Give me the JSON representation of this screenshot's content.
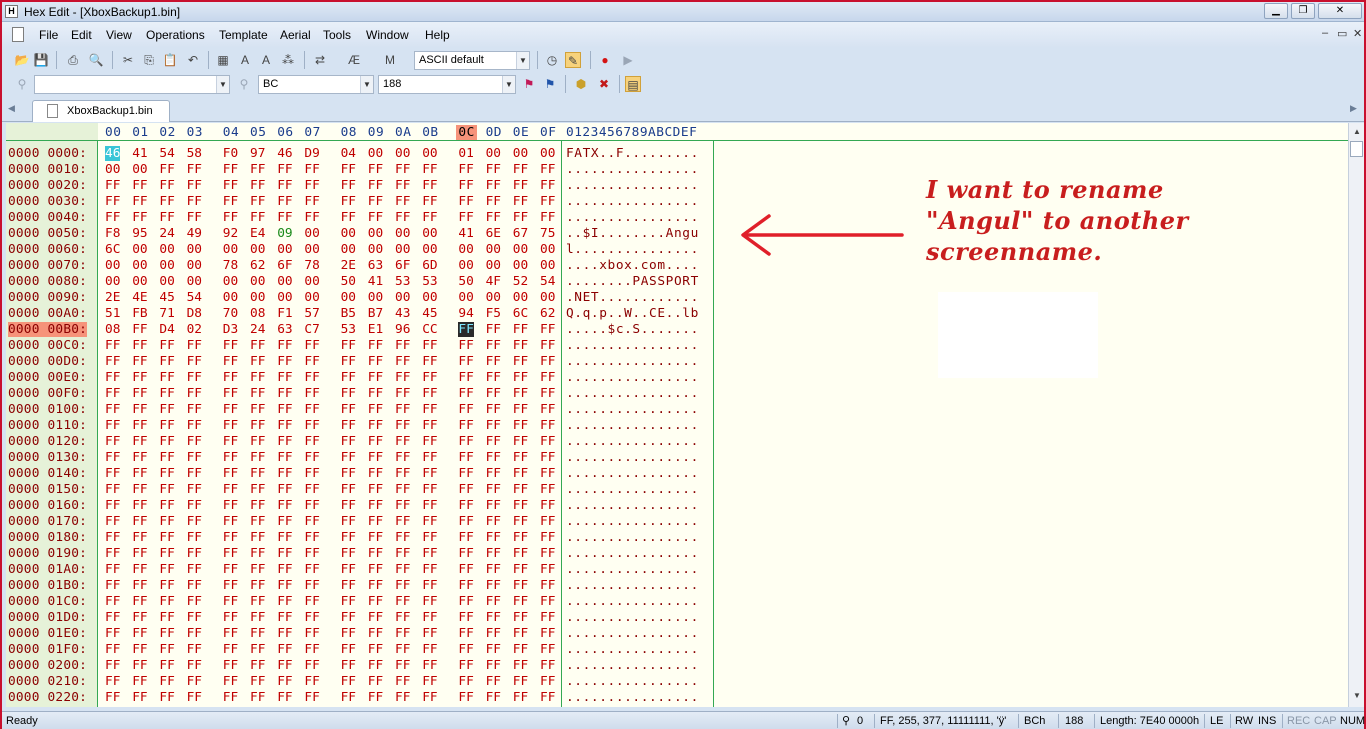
{
  "window": {
    "title": "Hex Edit - [XboxBackup1.bin]",
    "app_icon": "hex-app-icon"
  },
  "menu": [
    "File",
    "Edit",
    "View",
    "Operations",
    "Template",
    "Aerial",
    "Tools",
    "Window",
    "Help"
  ],
  "toolbar": {
    "charset_combo": "ASCII default",
    "find_combo": "",
    "hex_combo": "BC",
    "dec_combo": "188"
  },
  "tab": {
    "label": "XboxBackup1.bin"
  },
  "header": {
    "cols": [
      "00",
      "01",
      "02",
      "03",
      "04",
      "05",
      "06",
      "07",
      "08",
      "09",
      "0A",
      "0B",
      "0C",
      "0D",
      "0E",
      "0F"
    ],
    "ascii_header": "0123456789ABCDEF",
    "current_col": "0C"
  },
  "rows": [
    {
      "addr": "0000 0000:",
      "bytes": [
        "46",
        "41",
        "54",
        "58",
        "F0",
        "97",
        "46",
        "D9",
        "04",
        "00",
        "00",
        "00",
        "01",
        "00",
        "00",
        "00"
      ],
      "ascii": "FATX..F........."
    },
    {
      "addr": "0000 0010:",
      "bytes": [
        "00",
        "00",
        "FF",
        "FF",
        "FF",
        "FF",
        "FF",
        "FF",
        "FF",
        "FF",
        "FF",
        "FF",
        "FF",
        "FF",
        "FF",
        "FF"
      ],
      "ascii": "................"
    },
    {
      "addr": "0000 0020:",
      "bytes": [
        "FF",
        "FF",
        "FF",
        "FF",
        "FF",
        "FF",
        "FF",
        "FF",
        "FF",
        "FF",
        "FF",
        "FF",
        "FF",
        "FF",
        "FF",
        "FF"
      ],
      "ascii": "................"
    },
    {
      "addr": "0000 0030:",
      "bytes": [
        "FF",
        "FF",
        "FF",
        "FF",
        "FF",
        "FF",
        "FF",
        "FF",
        "FF",
        "FF",
        "FF",
        "FF",
        "FF",
        "FF",
        "FF",
        "FF"
      ],
      "ascii": "................"
    },
    {
      "addr": "0000 0040:",
      "bytes": [
        "FF",
        "FF",
        "FF",
        "FF",
        "FF",
        "FF",
        "FF",
        "FF",
        "FF",
        "FF",
        "FF",
        "FF",
        "FF",
        "FF",
        "FF",
        "FF"
      ],
      "ascii": "................"
    },
    {
      "addr": "0000 0050:",
      "bytes": [
        "F8",
        "95",
        "24",
        "49",
        "92",
        "E4",
        "09",
        "00",
        "00",
        "00",
        "00",
        "00",
        "41",
        "6E",
        "67",
        "75"
      ],
      "ascii": "..$I........Angu"
    },
    {
      "addr": "0000 0060:",
      "bytes": [
        "6C",
        "00",
        "00",
        "00",
        "00",
        "00",
        "00",
        "00",
        "00",
        "00",
        "00",
        "00",
        "00",
        "00",
        "00",
        "00"
      ],
      "ascii": "l..............."
    },
    {
      "addr": "0000 0070:",
      "bytes": [
        "00",
        "00",
        "00",
        "00",
        "78",
        "62",
        "6F",
        "78",
        "2E",
        "63",
        "6F",
        "6D",
        "00",
        "00",
        "00",
        "00"
      ],
      "ascii": "....xbox.com...."
    },
    {
      "addr": "0000 0080:",
      "bytes": [
        "00",
        "00",
        "00",
        "00",
        "00",
        "00",
        "00",
        "00",
        "50",
        "41",
        "53",
        "53",
        "50",
        "4F",
        "52",
        "54"
      ],
      "ascii": "........PASSPORT"
    },
    {
      "addr": "0000 0090:",
      "bytes": [
        "2E",
        "4E",
        "45",
        "54",
        "00",
        "00",
        "00",
        "00",
        "00",
        "00",
        "00",
        "00",
        "00",
        "00",
        "00",
        "00"
      ],
      "ascii": ".NET............"
    },
    {
      "addr": "0000 00A0:",
      "bytes": [
        "51",
        "FB",
        "71",
        "D8",
        "70",
        "08",
        "F1",
        "57",
        "B5",
        "B7",
        "43",
        "45",
        "94",
        "F5",
        "6C",
        "62"
      ],
      "ascii": "Q.q.p..W..CE..lb"
    },
    {
      "addr": "0000 00B0:",
      "bytes": [
        "08",
        "FF",
        "D4",
        "02",
        "D3",
        "24",
        "63",
        "C7",
        "53",
        "E1",
        "96",
        "CC",
        "FF",
        "FF",
        "FF",
        "FF"
      ],
      "ascii": ".....$c.S.......",
      "current": true
    },
    {
      "addr": "0000 00C0:",
      "bytes": [
        "FF",
        "FF",
        "FF",
        "FF",
        "FF",
        "FF",
        "FF",
        "FF",
        "FF",
        "FF",
        "FF",
        "FF",
        "FF",
        "FF",
        "FF",
        "FF"
      ],
      "ascii": "................"
    },
    {
      "addr": "0000 00D0:",
      "bytes": [
        "FF",
        "FF",
        "FF",
        "FF",
        "FF",
        "FF",
        "FF",
        "FF",
        "FF",
        "FF",
        "FF",
        "FF",
        "FF",
        "FF",
        "FF",
        "FF"
      ],
      "ascii": "................"
    },
    {
      "addr": "0000 00E0:",
      "bytes": [
        "FF",
        "FF",
        "FF",
        "FF",
        "FF",
        "FF",
        "FF",
        "FF",
        "FF",
        "FF",
        "FF",
        "FF",
        "FF",
        "FF",
        "FF",
        "FF"
      ],
      "ascii": "................"
    },
    {
      "addr": "0000 00F0:",
      "bytes": [
        "FF",
        "FF",
        "FF",
        "FF",
        "FF",
        "FF",
        "FF",
        "FF",
        "FF",
        "FF",
        "FF",
        "FF",
        "FF",
        "FF",
        "FF",
        "FF"
      ],
      "ascii": "................"
    },
    {
      "addr": "0000 0100:",
      "bytes": [
        "FF",
        "FF",
        "FF",
        "FF",
        "FF",
        "FF",
        "FF",
        "FF",
        "FF",
        "FF",
        "FF",
        "FF",
        "FF",
        "FF",
        "FF",
        "FF"
      ],
      "ascii": "................"
    },
    {
      "addr": "0000 0110:",
      "bytes": [
        "FF",
        "FF",
        "FF",
        "FF",
        "FF",
        "FF",
        "FF",
        "FF",
        "FF",
        "FF",
        "FF",
        "FF",
        "FF",
        "FF",
        "FF",
        "FF"
      ],
      "ascii": "................"
    },
    {
      "addr": "0000 0120:",
      "bytes": [
        "FF",
        "FF",
        "FF",
        "FF",
        "FF",
        "FF",
        "FF",
        "FF",
        "FF",
        "FF",
        "FF",
        "FF",
        "FF",
        "FF",
        "FF",
        "FF"
      ],
      "ascii": "................"
    },
    {
      "addr": "0000 0130:",
      "bytes": [
        "FF",
        "FF",
        "FF",
        "FF",
        "FF",
        "FF",
        "FF",
        "FF",
        "FF",
        "FF",
        "FF",
        "FF",
        "FF",
        "FF",
        "FF",
        "FF"
      ],
      "ascii": "................"
    },
    {
      "addr": "0000 0140:",
      "bytes": [
        "FF",
        "FF",
        "FF",
        "FF",
        "FF",
        "FF",
        "FF",
        "FF",
        "FF",
        "FF",
        "FF",
        "FF",
        "FF",
        "FF",
        "FF",
        "FF"
      ],
      "ascii": "................"
    },
    {
      "addr": "0000 0150:",
      "bytes": [
        "FF",
        "FF",
        "FF",
        "FF",
        "FF",
        "FF",
        "FF",
        "FF",
        "FF",
        "FF",
        "FF",
        "FF",
        "FF",
        "FF",
        "FF",
        "FF"
      ],
      "ascii": "................"
    },
    {
      "addr": "0000 0160:",
      "bytes": [
        "FF",
        "FF",
        "FF",
        "FF",
        "FF",
        "FF",
        "FF",
        "FF",
        "FF",
        "FF",
        "FF",
        "FF",
        "FF",
        "FF",
        "FF",
        "FF"
      ],
      "ascii": "................"
    },
    {
      "addr": "0000 0170:",
      "bytes": [
        "FF",
        "FF",
        "FF",
        "FF",
        "FF",
        "FF",
        "FF",
        "FF",
        "FF",
        "FF",
        "FF",
        "FF",
        "FF",
        "FF",
        "FF",
        "FF"
      ],
      "ascii": "................"
    },
    {
      "addr": "0000 0180:",
      "bytes": [
        "FF",
        "FF",
        "FF",
        "FF",
        "FF",
        "FF",
        "FF",
        "FF",
        "FF",
        "FF",
        "FF",
        "FF",
        "FF",
        "FF",
        "FF",
        "FF"
      ],
      "ascii": "................"
    },
    {
      "addr": "0000 0190:",
      "bytes": [
        "FF",
        "FF",
        "FF",
        "FF",
        "FF",
        "FF",
        "FF",
        "FF",
        "FF",
        "FF",
        "FF",
        "FF",
        "FF",
        "FF",
        "FF",
        "FF"
      ],
      "ascii": "................"
    },
    {
      "addr": "0000 01A0:",
      "bytes": [
        "FF",
        "FF",
        "FF",
        "FF",
        "FF",
        "FF",
        "FF",
        "FF",
        "FF",
        "FF",
        "FF",
        "FF",
        "FF",
        "FF",
        "FF",
        "FF"
      ],
      "ascii": "................"
    },
    {
      "addr": "0000 01B0:",
      "bytes": [
        "FF",
        "FF",
        "FF",
        "FF",
        "FF",
        "FF",
        "FF",
        "FF",
        "FF",
        "FF",
        "FF",
        "FF",
        "FF",
        "FF",
        "FF",
        "FF"
      ],
      "ascii": "................"
    },
    {
      "addr": "0000 01C0:",
      "bytes": [
        "FF",
        "FF",
        "FF",
        "FF",
        "FF",
        "FF",
        "FF",
        "FF",
        "FF",
        "FF",
        "FF",
        "FF",
        "FF",
        "FF",
        "FF",
        "FF"
      ],
      "ascii": "................"
    },
    {
      "addr": "0000 01D0:",
      "bytes": [
        "FF",
        "FF",
        "FF",
        "FF",
        "FF",
        "FF",
        "FF",
        "FF",
        "FF",
        "FF",
        "FF",
        "FF",
        "FF",
        "FF",
        "FF",
        "FF"
      ],
      "ascii": "................"
    },
    {
      "addr": "0000 01E0:",
      "bytes": [
        "FF",
        "FF",
        "FF",
        "FF",
        "FF",
        "FF",
        "FF",
        "FF",
        "FF",
        "FF",
        "FF",
        "FF",
        "FF",
        "FF",
        "FF",
        "FF"
      ],
      "ascii": "................"
    },
    {
      "addr": "0000 01F0:",
      "bytes": [
        "FF",
        "FF",
        "FF",
        "FF",
        "FF",
        "FF",
        "FF",
        "FF",
        "FF",
        "FF",
        "FF",
        "FF",
        "FF",
        "FF",
        "FF",
        "FF"
      ],
      "ascii": "................"
    },
    {
      "addr": "0000 0200:",
      "bytes": [
        "FF",
        "FF",
        "FF",
        "FF",
        "FF",
        "FF",
        "FF",
        "FF",
        "FF",
        "FF",
        "FF",
        "FF",
        "FF",
        "FF",
        "FF",
        "FF"
      ],
      "ascii": "................"
    },
    {
      "addr": "0000 0210:",
      "bytes": [
        "FF",
        "FF",
        "FF",
        "FF",
        "FF",
        "FF",
        "FF",
        "FF",
        "FF",
        "FF",
        "FF",
        "FF",
        "FF",
        "FF",
        "FF",
        "FF"
      ],
      "ascii": "................"
    },
    {
      "addr": "0000 0220:",
      "bytes": [
        "FF",
        "FF",
        "FF",
        "FF",
        "FF",
        "FF",
        "FF",
        "FF",
        "FF",
        "FF",
        "FF",
        "FF",
        "FF",
        "FF",
        "FF",
        "FF"
      ],
      "ascii": "................"
    }
  ],
  "annotation": {
    "lines": [
      "I want to rename",
      "\"Angul\" to another",
      "screenname."
    ],
    "color": "#c81e1e"
  },
  "status": {
    "ready": "Ready",
    "search_count": "0",
    "char_info": "FF, 255, 377, 11111111, 'ÿ'",
    "addr_hex": "BCh",
    "addr_dec": "188",
    "length": "Length: 7E40 0000h",
    "endian": "LE",
    "rw": "RW",
    "ins": "INS",
    "rec": "REC",
    "cap": "CAP",
    "num": "NUM"
  },
  "colors": {
    "hex_bytes": "#c00000",
    "selection": "#39c5d7",
    "current_row": "#f6937a",
    "address_bg": "#e6f2d8",
    "editor_bg": "#fffff2"
  }
}
